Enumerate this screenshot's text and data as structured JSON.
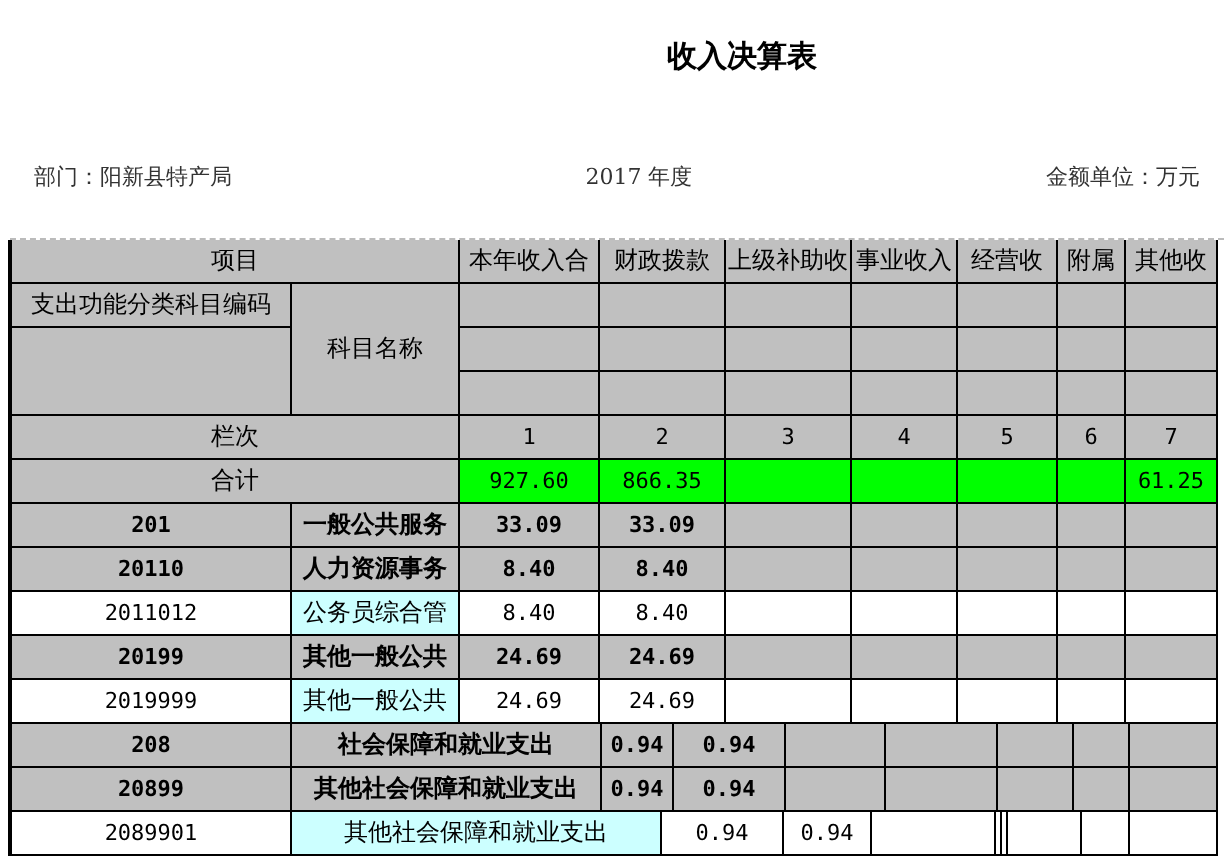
{
  "title": "收入决算表",
  "department": "部门：阳新县特产局",
  "year": "2017 年度",
  "unit": "金额单位：万元",
  "table": {
    "header": "项目",
    "columns": [
      "本年收入合",
      "财政拨款",
      "上级补助收",
      "事业收入",
      "经营收",
      "附属",
      "其他收"
    ],
    "code_header": "支出功能分类科目编码",
    "name_header": "科目名称",
    "index_label": "栏次",
    "indices": [
      "1",
      "2",
      "3",
      "4",
      "5",
      "6",
      "7"
    ],
    "total": {
      "label": "合计",
      "cells": [
        {
          "value": "927.60",
          "highlighted": true
        },
        {
          "value": "866.35",
          "highlighted": true
        },
        {
          "highlighted": true
        },
        {
          "highlighted": true
        },
        {
          "highlighted": true
        },
        {
          "highlighted": true
        },
        {
          "value": "61.25",
          "highlighted": true
        }
      ]
    },
    "rows": [
      {
        "kind": "section",
        "code": "201",
        "name": "一般公共服务",
        "values": [
          "33.09",
          "33.09"
        ]
      },
      {
        "kind": "section",
        "code": "20110",
        "name": "人力资源事务",
        "values": [
          "8.40",
          "8.40"
        ]
      },
      {
        "kind": "item",
        "code": "2011012",
        "name": "公务员综合管",
        "values": [
          "8.40",
          "8.40"
        ]
      },
      {
        "kind": "section",
        "code": "20199",
        "name": "其他一般公共",
        "values": [
          "24.69",
          "24.69"
        ]
      },
      {
        "kind": "item",
        "code": "2019999",
        "name": "其他一般公共",
        "values": [
          "24.69",
          "24.69"
        ]
      },
      {
        "kind": "wide_section",
        "code": "208",
        "name": "社会保障和就业支出",
        "values": [
          "0.94",
          "0.94"
        ]
      },
      {
        "kind": "wide_section",
        "code": "20899",
        "name": "其他社会保障和就业支出",
        "values": [
          "0.94",
          "0.94"
        ]
      },
      {
        "kind": "wide_item",
        "code": "2089901",
        "name": "其他社会保障和就业支出",
        "values": [
          "0.94",
          "0.94"
        ]
      }
    ]
  }
}
